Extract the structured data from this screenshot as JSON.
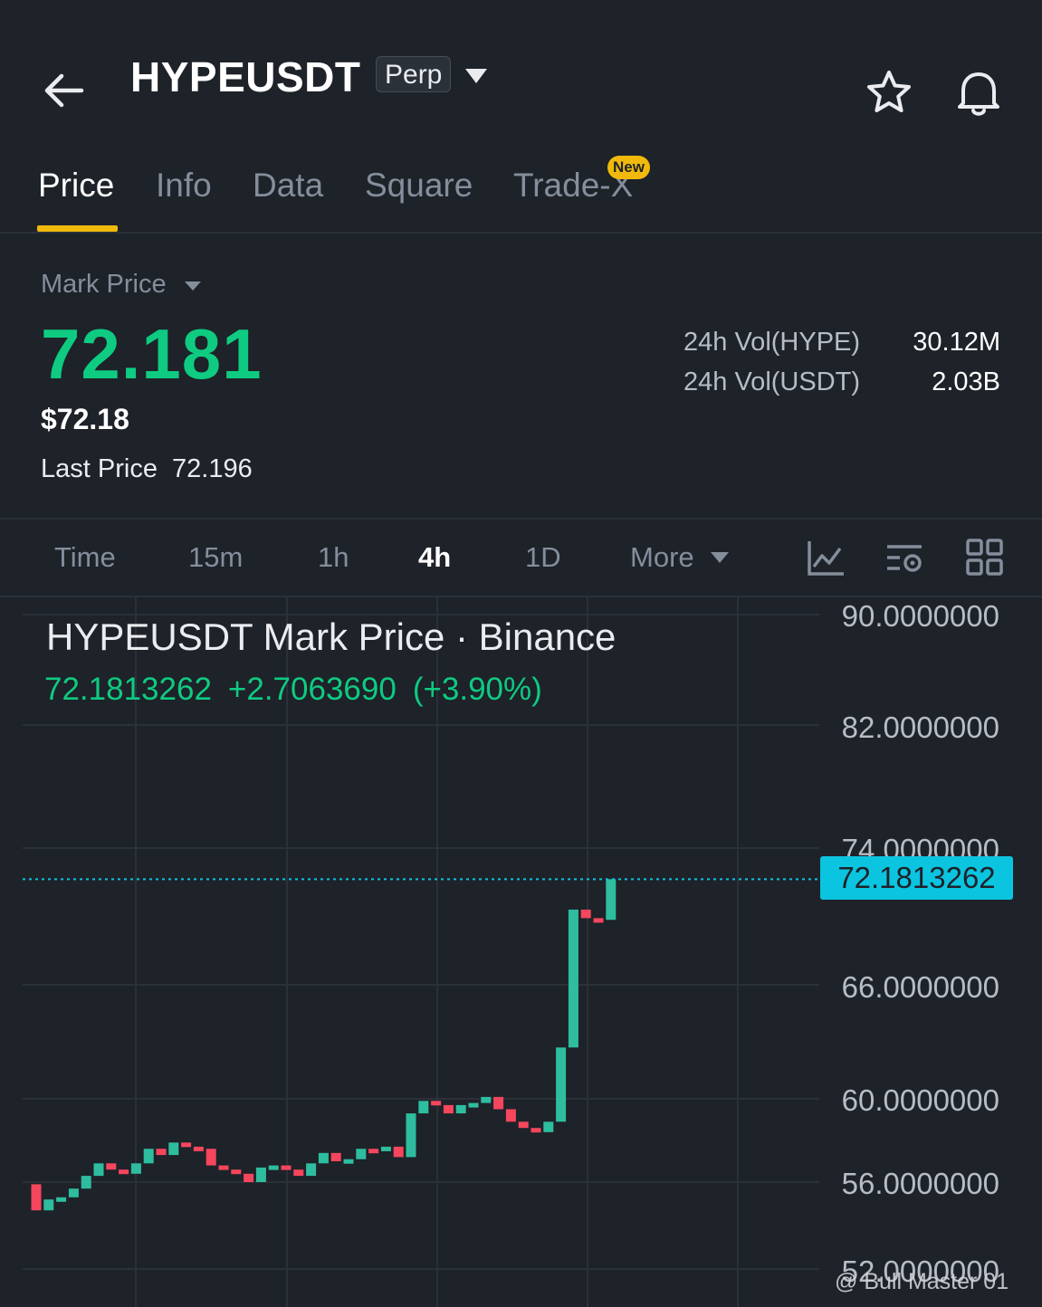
{
  "header": {
    "symbol": "HYPEUSDT",
    "contract_type": "Perp",
    "icons": [
      "back-arrow-icon",
      "chevron-down-icon",
      "star-icon",
      "bell-icon"
    ]
  },
  "tabs": [
    {
      "label": "Price",
      "active": true
    },
    {
      "label": "Info",
      "active": false
    },
    {
      "label": "Data",
      "active": false
    },
    {
      "label": "Square",
      "active": false
    },
    {
      "label": "Trade-X",
      "active": false,
      "badge": "New"
    }
  ],
  "price_panel": {
    "mark_label": "Mark Price",
    "mark_price": "72.181",
    "usd_price": "$72.18",
    "last_price_label": "Last Price",
    "last_price": "72.196",
    "volumes": [
      {
        "label": "24h Vol(HYPE)",
        "value": "30.12M"
      },
      {
        "label": "24h Vol(USDT)",
        "value": "2.03B"
      }
    ]
  },
  "intervals": [
    {
      "label": "Time",
      "active": false
    },
    {
      "label": "15m",
      "active": false
    },
    {
      "label": "1h",
      "active": false
    },
    {
      "label": "4h",
      "active": true
    },
    {
      "label": "1D",
      "active": false
    },
    {
      "label": "More",
      "active": false
    }
  ],
  "tools": [
    "chart-type-icon",
    "indicator-settings-icon",
    "grid-layout-icon"
  ],
  "chart": {
    "title": "HYPEUSDT Mark Price · Binance",
    "last": "72.1813262",
    "change": "+2.7063690",
    "change_pct": "(+3.90%)",
    "price_tag": "72.1813262",
    "watermark": "@ Bull Master 01"
  },
  "colors": {
    "background": "#1e2229",
    "up": "#0ecb81",
    "up_candle": "#2ebd9f",
    "down_candle": "#f6465d",
    "accent": "#f0b90b",
    "price_line": "#0bc4e0"
  },
  "chart_data": {
    "type": "candlestick",
    "y_tick_labels": [
      "90.0000000",
      "82.0000000",
      "74.0000000",
      "66.0000000",
      "60.0000000",
      "56.0000000",
      "52.0000000"
    ],
    "y_ticks": [
      90,
      82,
      74,
      66,
      60,
      56,
      52
    ],
    "current_price": 72.1813262,
    "candles": [
      {
        "o": 55.9,
        "c": 54.7
      },
      {
        "o": 54.7,
        "c": 55.2
      },
      {
        "o": 55.2,
        "c": 55.3
      },
      {
        "o": 55.3,
        "c": 55.7
      },
      {
        "o": 55.7,
        "c": 56.3
      },
      {
        "o": 56.3,
        "c": 56.9
      },
      {
        "o": 56.9,
        "c": 56.6
      },
      {
        "o": 56.6,
        "c": 56.4
      },
      {
        "o": 56.4,
        "c": 56.9
      },
      {
        "o": 56.9,
        "c": 57.6
      },
      {
        "o": 57.6,
        "c": 57.3
      },
      {
        "o": 57.3,
        "c": 57.9
      },
      {
        "o": 57.9,
        "c": 57.7
      },
      {
        "o": 57.7,
        "c": 57.6
      },
      {
        "o": 57.6,
        "c": 56.8
      },
      {
        "o": 56.8,
        "c": 56.6
      },
      {
        "o": 56.6,
        "c": 56.4
      },
      {
        "o": 56.4,
        "c": 56.0
      },
      {
        "o": 56.0,
        "c": 56.7
      },
      {
        "o": 56.7,
        "c": 56.8
      },
      {
        "o": 56.8,
        "c": 56.6
      },
      {
        "o": 56.6,
        "c": 56.3
      },
      {
        "o": 56.3,
        "c": 56.9
      },
      {
        "o": 56.9,
        "c": 57.4
      },
      {
        "o": 57.4,
        "c": 57.0
      },
      {
        "o": 57.0,
        "c": 57.1
      },
      {
        "o": 57.1,
        "c": 57.6
      },
      {
        "o": 57.6,
        "c": 57.5
      },
      {
        "o": 57.5,
        "c": 57.7
      },
      {
        "o": 57.7,
        "c": 57.2
      },
      {
        "o": 57.2,
        "c": 59.3
      },
      {
        "o": 59.3,
        "c": 59.9
      },
      {
        "o": 59.9,
        "c": 59.7
      },
      {
        "o": 59.7,
        "c": 59.3
      },
      {
        "o": 59.3,
        "c": 59.7
      },
      {
        "o": 59.7,
        "c": 59.8
      },
      {
        "o": 59.8,
        "c": 60.1
      },
      {
        "o": 60.1,
        "c": 59.5
      },
      {
        "o": 59.5,
        "c": 58.9
      },
      {
        "o": 58.9,
        "c": 58.6
      },
      {
        "o": 58.6,
        "c": 58.4
      },
      {
        "o": 58.4,
        "c": 58.9
      },
      {
        "o": 58.9,
        "c": 62.7
      },
      {
        "o": 62.7,
        "c": 70.4
      },
      {
        "o": 70.4,
        "c": 69.9
      },
      {
        "o": 69.9,
        "c": 69.8
      },
      {
        "o": 69.8,
        "c": 72.18
      }
    ]
  }
}
